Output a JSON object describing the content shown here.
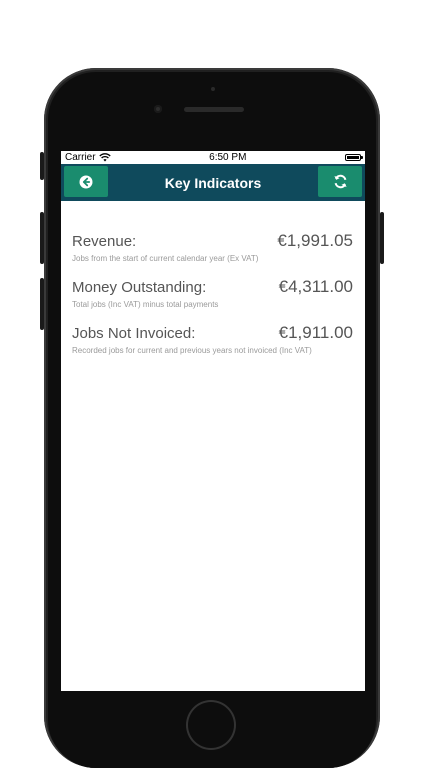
{
  "status_bar": {
    "carrier": "Carrier",
    "time": "6:50 PM"
  },
  "nav": {
    "title": "Key Indicators",
    "back_icon": "arrow-left-circle-icon",
    "refresh_icon": "refresh-icon",
    "bar_color": "#0f4a5c",
    "button_color": "#1a8c6e"
  },
  "indicators": [
    {
      "label": "Revenue:",
      "value": "€1,991.05",
      "description": "Jobs from the start of current calendar year (Ex VAT)"
    },
    {
      "label": "Money Outstanding:",
      "value": "€4,311.00",
      "description": "Total jobs (Inc VAT) minus total payments"
    },
    {
      "label": "Jobs Not Invoiced:",
      "value": "€1,911.00",
      "description": "Recorded jobs for current and previous years not invoiced (Inc VAT)"
    }
  ]
}
